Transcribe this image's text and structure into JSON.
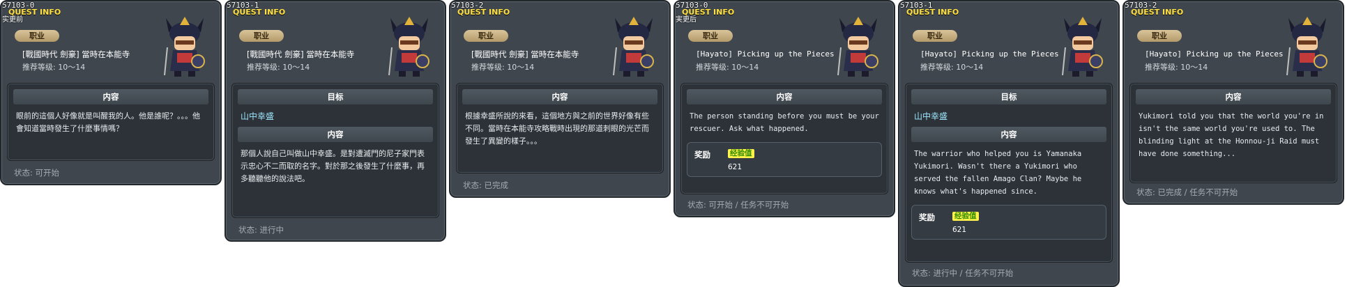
{
  "common": {
    "header": "QUEST INFO",
    "job_label": "职业",
    "level": "推荐等级: 10～14",
    "content_label": "内容",
    "target_label": "目标",
    "reward_label": "奖励",
    "exp_label": "经验值"
  },
  "panels": [
    {
      "quest_id": "57103-0",
      "pre_label": "实更前",
      "title": "[戰國時代 劍豪] 當時在本能寺",
      "content": "眼前的這個人好像就是叫醒我的人。他是誰呢？。。。他會知道當時發生了什麼事情嗎？",
      "status": "状态:  可开始"
    },
    {
      "quest_id": "57103-1",
      "title": "[戰國時代 劍豪] 當時在本能寺",
      "target_name": "山中幸盛",
      "content": "那個人說自己叫做山中幸盛。是對遭滅門的尼子家門表示忠心不二而取的名字。對於那之後發生了什麼事，再多聽聽他的說法吧。",
      "status": "状态:  进行中"
    },
    {
      "quest_id": "57103-2",
      "title": "[戰國時代 劍豪] 當時在本能寺",
      "content": "根據幸盛所說的來看，這個地方與之前的世界好像有些不同。當時在本能寺攻略戰時出現的那道刺眼的光芒而發生了異變的樣子。。。",
      "status": "状态:  已完成"
    },
    {
      "quest_id": "57103-0",
      "pre_label": "実更后",
      "title": "[Hayato] Picking up the Pieces",
      "content": "The person standing before you must be your rescuer. Ask what happened.",
      "exp_value": "621",
      "status": "状态:  可开始 / 任务不可开始"
    },
    {
      "quest_id": "57103-1",
      "title": "[Hayato] Picking up the Pieces",
      "target_name": "山中幸盛",
      "content": "The warrior who helped you is Yamanaka Yukimori. Wasn't there a Yukimori who served the fallen Amago Clan? Maybe he knows what's happened since.",
      "exp_value": "621",
      "status": "状态:  进行中 / 任务不可开始"
    },
    {
      "quest_id": "57103-2",
      "title": "[Hayato] Picking up the Pieces",
      "content": "Yukimori told you that the world you're in isn't the same world you're used to. The blinding light at the Honnou-ji Raid must have done something...",
      "status": "状态:  已完成 / 任务不可开始"
    }
  ]
}
